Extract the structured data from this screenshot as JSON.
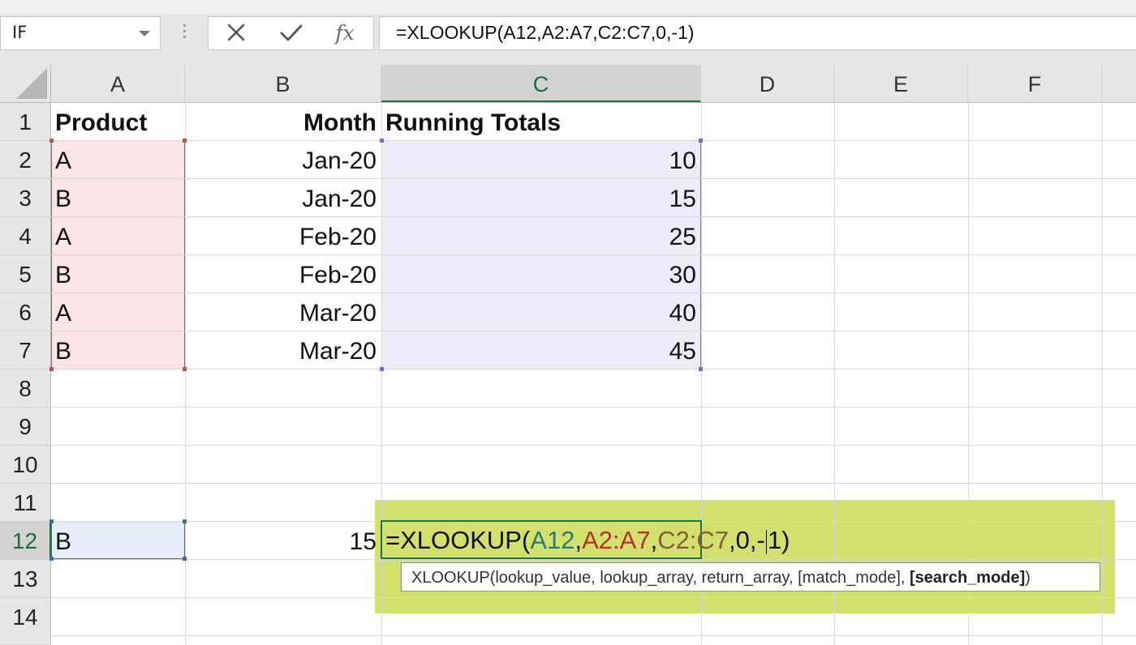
{
  "formula_bar": {
    "name_box": "IF",
    "fx_label": "fx",
    "formula": "=XLOOKUP(A12,A2:A7,C2:C7,0,-1)"
  },
  "columns": [
    "A",
    "B",
    "C",
    "D",
    "E",
    "F"
  ],
  "active_column": "C",
  "rows": [
    "1",
    "2",
    "3",
    "4",
    "5",
    "6",
    "7",
    "8",
    "9",
    "10",
    "11",
    "12",
    "13",
    "14"
  ],
  "active_row": "12",
  "headers": {
    "a1": "Product",
    "b1": "Month",
    "c1": "Running Totals"
  },
  "data_rows": [
    {
      "product": "A",
      "month": "Jan-20",
      "total": "10"
    },
    {
      "product": "B",
      "month": "Jan-20",
      "total": "15"
    },
    {
      "product": "A",
      "month": "Feb-20",
      "total": "25"
    },
    {
      "product": "B",
      "month": "Feb-20",
      "total": "30"
    },
    {
      "product": "A",
      "month": "Mar-20",
      "total": "40"
    },
    {
      "product": "B",
      "month": "Mar-20",
      "total": "45"
    }
  ],
  "row12": {
    "a12": "B",
    "b12": "15"
  },
  "edit": {
    "prefix": "=XLOOKUP(",
    "arg1": "A12",
    "arg2": "A2:A7",
    "arg3": "C2:C7",
    "rest_before_caret": ",0,-",
    "rest_after_caret": "1)"
  },
  "tooltip": {
    "text": "XLOOKUP(lookup_value, lookup_array, return_array, [match_mode], ",
    "bold_arg": "[search_mode]",
    "close": ")"
  },
  "colors": {
    "arg1": "#2b7a6b",
    "arg2": "#b0332f",
    "arg3": "#8a5a3c",
    "highlight": "#d2e06d",
    "excel_green": "#217346"
  }
}
